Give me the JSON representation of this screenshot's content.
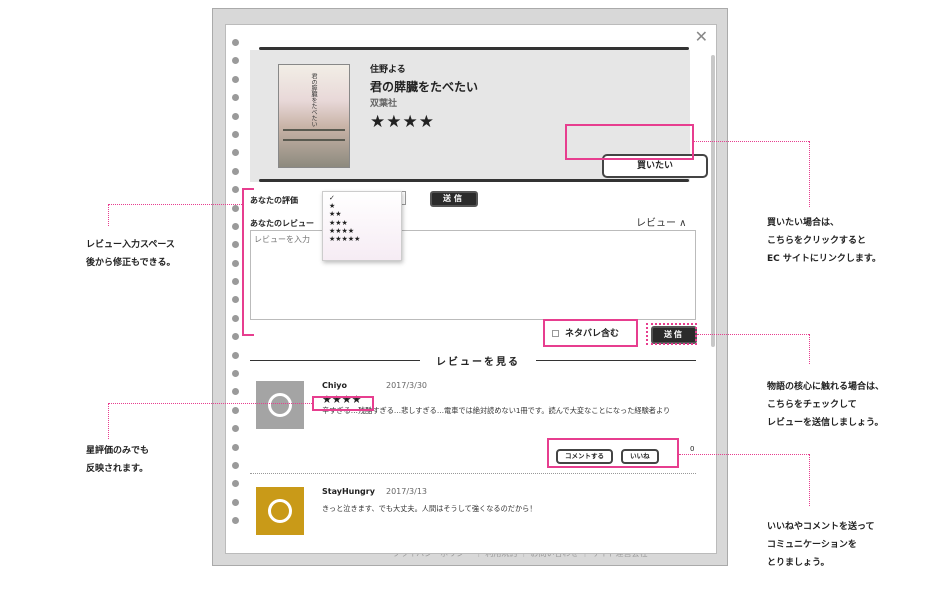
{
  "bg_footer": "プライバシーポリシー ｜ 利用規約 ｜ お問い合わせ ｜ サイト運営会社",
  "modal": {
    "close": "✕"
  },
  "book": {
    "cover_title": "君の膵臓をたべたい",
    "author": "住野よる",
    "title": "君の膵臓をたべたい",
    "publisher": "双葉社",
    "stars": "★★★★",
    "buy_label": "買いたい"
  },
  "form": {
    "rating_label": "あなたの評価",
    "rating_options": [
      "✓",
      "★",
      "★★",
      "★★★",
      "★★★★",
      "★★★★★"
    ],
    "send_small": "送信",
    "review_label": "あなたのレビュー",
    "review_toggle": "レビュー ∧",
    "review_placeholder": "レビューを入力",
    "spoiler_label": "ネタバレ含む",
    "send_label": "送信"
  },
  "reviews_section": {
    "title": "レビューを見る"
  },
  "reviews": [
    {
      "user": "Chiyo",
      "date": "2017/3/30",
      "stars": "★★★★",
      "text": "辛すぎる…残酷すぎる…悲しすぎる…電車では絶対読めない1冊です。読んで大変なことになった経験者より",
      "comment_label": "コメントする",
      "like_label": "いいね",
      "like_count": "0"
    },
    {
      "user": "StayHungry",
      "date": "2017/3/13",
      "text": "きっと泣きます、でも大丈夫。人間はそうして強くなるのだから！"
    }
  ],
  "annotations": {
    "left_review_input": [
      "レビュー入力スペース",
      "後から修正もできる。"
    ],
    "left_stars": [
      "星評価のみでも",
      "反映されます。"
    ],
    "right_buy": [
      "買いたい場合は、",
      "こちらをクリックすると",
      "EC サイトにリンクします。"
    ],
    "right_spoiler": [
      "物語の核心に触れる場合は、",
      "こちらをチェックして",
      "レビューを送信しましょう。"
    ],
    "right_like": [
      "いいねやコメントを送って",
      "コミュニケーションを",
      "とりましょう。"
    ]
  },
  "colors": {
    "highlight": "#e73e8f",
    "button_dark": "#2b2b2b",
    "panel": "#e6e6e6"
  }
}
